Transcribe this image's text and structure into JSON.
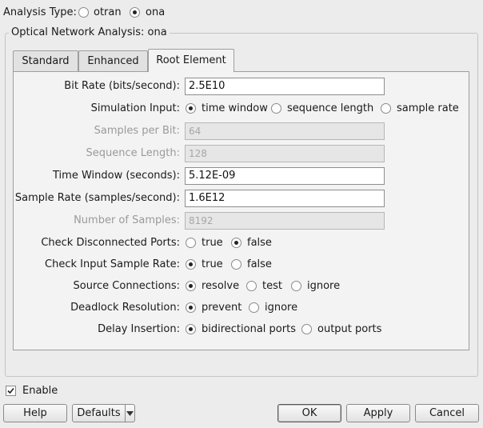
{
  "analysis_type": {
    "label": "Analysis Type:",
    "options": [
      "otran",
      "ona"
    ],
    "selected": "ona"
  },
  "group": {
    "title": "Optical Network Analysis: ona"
  },
  "tabs": [
    {
      "label": "Standard",
      "active": false
    },
    {
      "label": "Enhanced",
      "active": false
    },
    {
      "label": "Root Element",
      "active": true
    }
  ],
  "form": {
    "bit_rate": {
      "label": "Bit Rate (bits/second):",
      "value": "2.5E10"
    },
    "simulation_input": {
      "label": "Simulation Input:",
      "options": [
        "time window",
        "sequence length",
        "sample rate"
      ],
      "selected": "time window"
    },
    "samples_per_bit": {
      "label": "Samples per Bit:",
      "value": "64"
    },
    "sequence_length": {
      "label": "Sequence Length:",
      "value": "128"
    },
    "time_window": {
      "label": "Time Window (seconds):",
      "value": "5.12E-09"
    },
    "sample_rate": {
      "label": "Sample Rate (samples/second):",
      "value": "1.6E12"
    },
    "number_of_samples": {
      "label": "Number of Samples:",
      "value": "8192"
    },
    "check_disconnected": {
      "label": "Check Disconnected Ports:",
      "options": [
        "true",
        "false"
      ],
      "selected": "false"
    },
    "check_input_rate": {
      "label": "Check Input Sample Rate:",
      "options": [
        "true",
        "false"
      ],
      "selected": "true"
    },
    "source_connections": {
      "label": "Source Connections:",
      "options": [
        "resolve",
        "test",
        "ignore"
      ],
      "selected": "resolve"
    },
    "deadlock_resolution": {
      "label": "Deadlock Resolution:",
      "options": [
        "prevent",
        "ignore"
      ],
      "selected": "prevent"
    },
    "delay_insertion": {
      "label": "Delay Insertion:",
      "options": [
        "bidirectional ports",
        "output ports"
      ],
      "selected": "bidirectional ports"
    }
  },
  "enable": {
    "label": "Enable",
    "checked": true
  },
  "buttons": {
    "help": "Help",
    "defaults": "Defaults",
    "ok": "OK",
    "apply": "Apply",
    "cancel": "Cancel"
  },
  "icons": {
    "checkbox": "check-icon",
    "dropdown": "triangle-down-icon"
  }
}
